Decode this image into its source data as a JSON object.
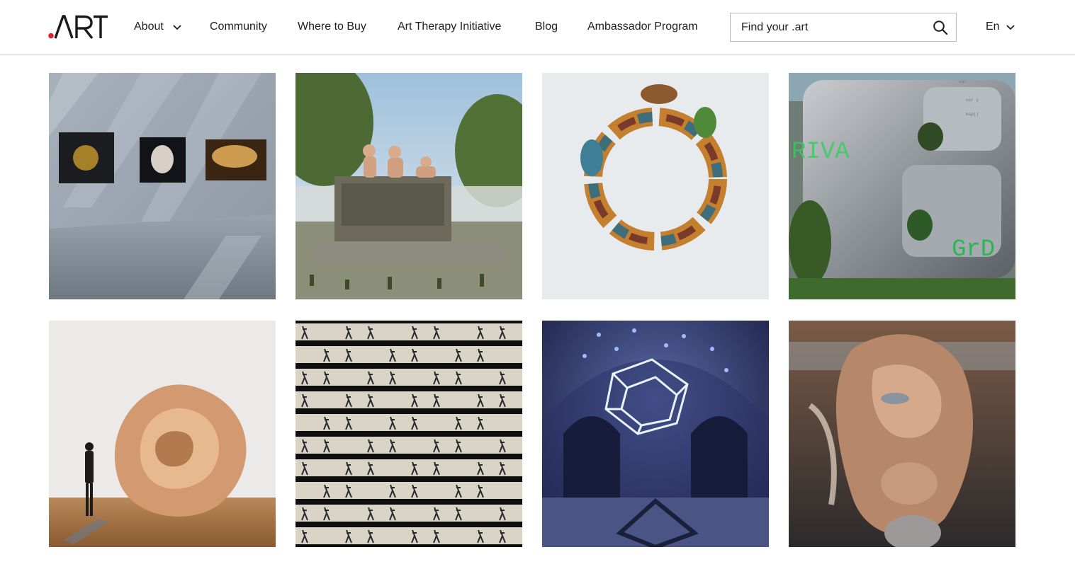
{
  "header": {
    "logo_text": ".ART",
    "nav": [
      {
        "label": "About",
        "has_dropdown": true
      },
      {
        "label": "Community"
      },
      {
        "label": "Where to Buy"
      },
      {
        "label": "Art Therapy Initiative"
      },
      {
        "label": "Blog"
      },
      {
        "label": "Ambassador Program"
      }
    ],
    "search": {
      "placeholder": "Find your .art",
      "icon": "search-icon"
    },
    "language": {
      "label": "En",
      "icon": "chevron-down-icon"
    }
  },
  "gallery": {
    "tiles": [
      {
        "subject": "virtual gallery wall with three framed works"
      },
      {
        "subject": "stone sarcophagus with sculpted figures in a garden"
      },
      {
        "subject": "ring of intertwined serpents"
      },
      {
        "subject": "chrome sculpture with plants and green code text"
      },
      {
        "subject": "copper ribbon sculpture with a standing visitor"
      },
      {
        "subject": "grid of repeated dancing figures"
      },
      {
        "subject": "glowing tesseract in a domed hall"
      },
      {
        "subject": "distorted surreal portrait figure"
      }
    ]
  },
  "colors": {
    "logo_dot": "#e01e2b",
    "text": "#1f1f1f",
    "divider": "#cfcfcf",
    "search_border": "#b9b9b9"
  }
}
